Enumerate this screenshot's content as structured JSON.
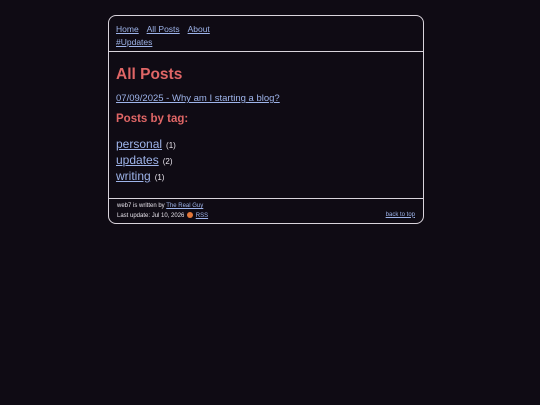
{
  "nav": {
    "links": [
      "Home",
      "All Posts",
      "About",
      "#Updates"
    ]
  },
  "main": {
    "title": "All Posts",
    "posts": [
      {
        "label": "07/09/2025 - Why am I starting a blog?"
      }
    ],
    "tags_heading": "Posts by tag:",
    "tags": [
      {
        "name": "personal",
        "count": "(1)"
      },
      {
        "name": "updates",
        "count": "(2)"
      },
      {
        "name": "writing",
        "count": "(1)"
      }
    ]
  },
  "footer": {
    "written_by_text": "web7 is written by",
    "author": "The Real Guy",
    "last_update_text": "Last update: Jul 10, 2026",
    "rss_label": "RSS",
    "back_to_top": "back to top"
  },
  "colors": {
    "background": "#0f0b14",
    "heading": "#e06666",
    "link": "#9eb4ea",
    "border": "#d9d4dc",
    "rss": "#e2773a"
  },
  "icons": [
    "rss-icon"
  ]
}
